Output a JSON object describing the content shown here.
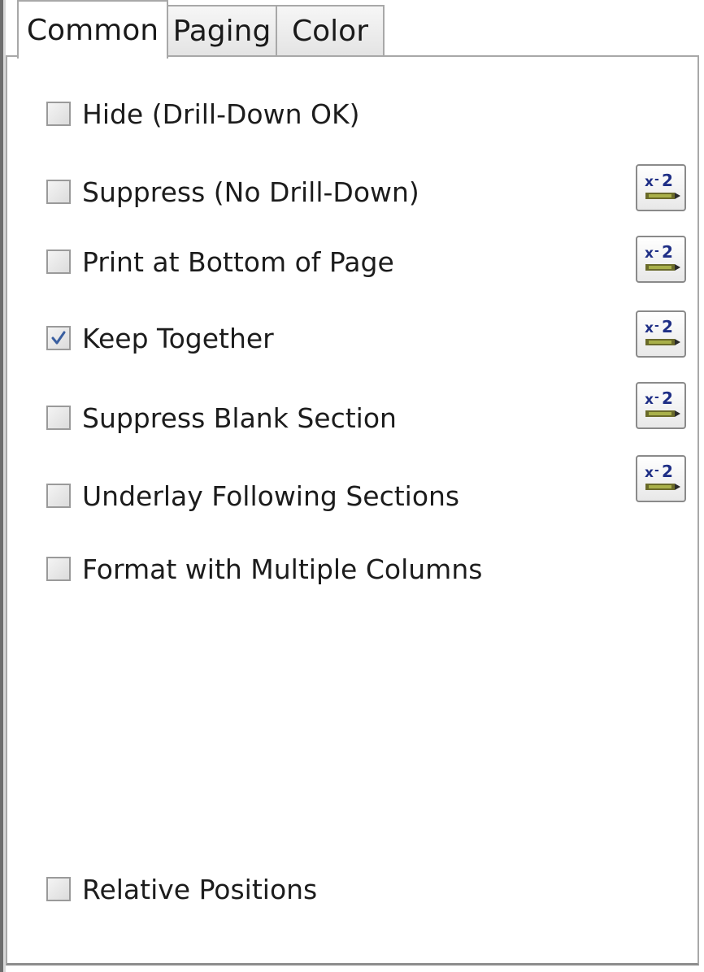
{
  "tabs": [
    {
      "label": "Common",
      "active": true
    },
    {
      "label": "Paging",
      "active": false
    },
    {
      "label": "Color",
      "active": false
    }
  ],
  "options": [
    {
      "label": "Hide (Drill-Down OK)",
      "checked": false,
      "has_formula": false
    },
    {
      "label": "Suppress (No Drill-Down)",
      "checked": false,
      "has_formula": true
    },
    {
      "label": "Print at Bottom of Page",
      "checked": false,
      "has_formula": true
    },
    {
      "label": "Keep Together",
      "checked": true,
      "has_formula": true
    },
    {
      "label": "Suppress Blank Section",
      "checked": false,
      "has_formula": true
    },
    {
      "label": "Underlay Following Sections",
      "checked": false,
      "has_formula": true
    },
    {
      "label": "Format with Multiple Columns",
      "checked": false,
      "has_formula": false
    },
    {
      "label": "Relative Positions",
      "checked": false,
      "has_formula": false
    }
  ],
  "formula_button": {
    "icon": "formula-x2-icon",
    "text": "x-2"
  },
  "colors": {
    "check": "#3a5fa0",
    "formula_text": "#1f2f86"
  }
}
